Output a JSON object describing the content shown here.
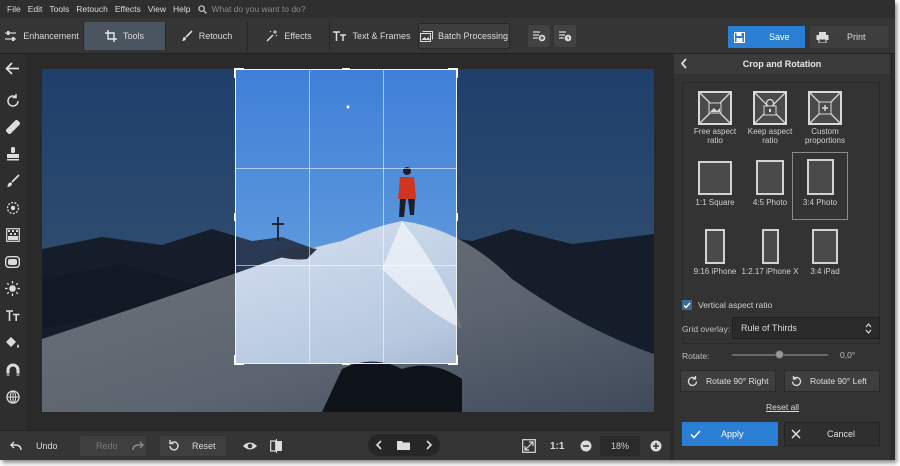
{
  "menu": {
    "items": [
      "File",
      "Edit",
      "Tools",
      "Retouch",
      "Effects",
      "View",
      "Help"
    ],
    "search_placeholder": "What do you want to do?"
  },
  "toolbar": {
    "tabs": [
      {
        "label": "Enhancement",
        "icon": "sliders-icon"
      },
      {
        "label": "Tools",
        "icon": "crop-icon",
        "active": true
      },
      {
        "label": "Retouch",
        "icon": "brush-icon"
      },
      {
        "label": "Effects",
        "icon": "magic-wand-icon"
      },
      {
        "label": "Text & Frames",
        "icon": "text-icon"
      }
    ],
    "batch_label": "Batch Processing",
    "save_label": "Save",
    "print_label": "Print"
  },
  "leftbar": {
    "icons": [
      "back-arrow-icon",
      "rotate-icon",
      "healing-icon",
      "stamp-icon",
      "brush-icon",
      "radial-icon",
      "gradient-icon",
      "vignette-icon",
      "light-icon",
      "text-icon",
      "fill-icon",
      "magnet-icon",
      "globe-icon"
    ]
  },
  "bottombar": {
    "undo_label": "Undo",
    "redo_label": "Redo",
    "reset_label": "Reset",
    "one_to_one": "1:1",
    "zoom": "18%"
  },
  "crop_panel": {
    "title": "Crop and Rotation",
    "ratios": [
      {
        "label": "Free aspect ratio"
      },
      {
        "label": "Keep aspect ratio"
      },
      {
        "label": "Custom proportions"
      },
      {
        "label": "1:1 Square"
      },
      {
        "label": "4:5 Photo"
      },
      {
        "label": "3:4 Photo",
        "selected": true
      },
      {
        "label": "9:16 iPhone"
      },
      {
        "label": "1:2.17 iPhone X"
      },
      {
        "label": "3:4 iPad"
      }
    ],
    "vertical_label": "Vertical aspect ratio",
    "vertical_checked": true,
    "grid_label": "Grid overlay:",
    "grid_value": "Rule of Thirds",
    "rotate_label": "Rotate:",
    "rotate_value": "0,0°",
    "rotate_right_label": "Rotate 90° Right",
    "rotate_left_label": "Rotate 90° Left",
    "reset_all_label": "Reset all",
    "apply_label": "Apply",
    "cancel_label": "Cancel"
  }
}
